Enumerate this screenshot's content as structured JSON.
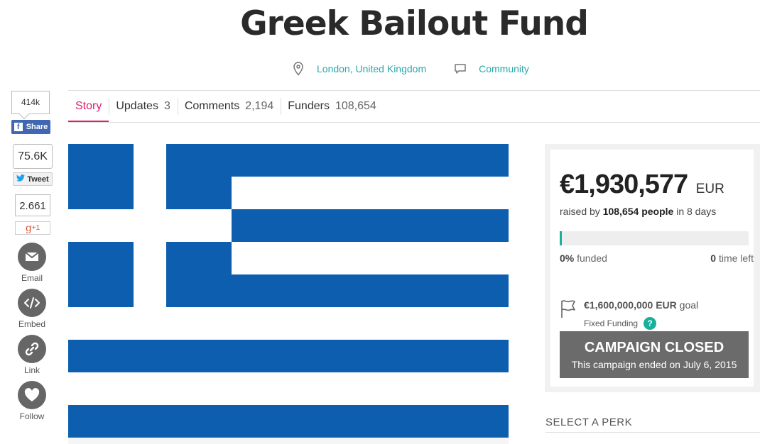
{
  "campaign": {
    "title": "Greek Bailout Fund",
    "location": "London, United Kingdom",
    "category": "Community"
  },
  "tabs": [
    {
      "label": "Story",
      "count": ""
    },
    {
      "label": "Updates",
      "count": "3"
    },
    {
      "label": "Comments",
      "count": "2,194"
    },
    {
      "label": "Funders",
      "count": "108,654"
    }
  ],
  "social": {
    "facebook": {
      "count": "414k",
      "label": "Share",
      "icon": "facebook-icon"
    },
    "twitter": {
      "count": "75.6K",
      "label": "Tweet",
      "icon": "twitter-bird-icon"
    },
    "gplus": {
      "count": "2.661",
      "label": "+1",
      "icon": "g-icon",
      "glyph": "g"
    },
    "actions": [
      {
        "label": "Email",
        "icon": "envelope-icon"
      },
      {
        "label": "Embed",
        "icon": "code-icon"
      },
      {
        "label": "Link",
        "icon": "link-icon"
      },
      {
        "label": "Follow",
        "icon": "heart-icon"
      }
    ]
  },
  "stats": {
    "amount": "€1,930,577",
    "currency": "EUR",
    "raised_prefix": "raised by",
    "people": "108,654 people",
    "raised_suffix": "in 8 days",
    "progress_fraction": 0.01,
    "funded_value": "0%",
    "funded_label": "funded",
    "time_value": "0",
    "time_label": "time left",
    "goal_value": "€1,600,000,000 EUR",
    "goal_label": "goal",
    "funding_type": "Fixed Funding",
    "help_glyph": "?",
    "closed_title": "CAMPAIGN CLOSED",
    "closed_subtitle": "This campaign ended on July 6, 2015"
  },
  "perk_heading": "SELECT A PERK",
  "colors": {
    "accent_pink": "#e51c71",
    "link_teal": "#2ba8ab",
    "progress_green": "#1aaf9a",
    "flag_blue": "#0d5eaf",
    "facebook_blue": "#4267b2"
  }
}
